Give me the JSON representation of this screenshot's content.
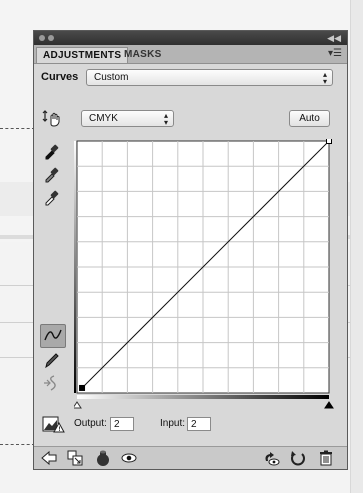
{
  "panel": {
    "tabs": [
      {
        "label": "ADJUSTMENTS",
        "active": true
      },
      {
        "label": "MASKS",
        "active": false
      }
    ],
    "menu_icon": "panel-menu-icon"
  },
  "curves": {
    "title": "Curves",
    "preset": "Custom",
    "channel": "CMYK",
    "auto_label": "Auto"
  },
  "tools": {
    "adjust": "hand-adjust-icon",
    "eyedroppers": [
      "black-point-eyedropper-icon",
      "gray-point-eyedropper-icon",
      "white-point-eyedropper-icon"
    ],
    "edit_points": "curve-points-icon",
    "pencil": "pencil-icon",
    "smooth": "smooth-curve-icon",
    "clipping": "clipping-warning-icon"
  },
  "io": {
    "output_label": "Output:",
    "output_value": "2",
    "input_label": "Input:",
    "input_value": "2"
  },
  "bottom_icons": [
    "return-arrow-icon",
    "clip-to-layer-icon",
    "visibility-icon",
    "view-previous-icon",
    "reset-icon",
    "trash-icon"
  ],
  "chart_data": {
    "type": "line",
    "xlim": [
      0,
      100
    ],
    "ylim": [
      0,
      100
    ],
    "grid": true,
    "grid_divisions": 10,
    "series": [
      {
        "values": [
          [
            2,
            2
          ],
          [
            100,
            100
          ]
        ]
      }
    ]
  }
}
